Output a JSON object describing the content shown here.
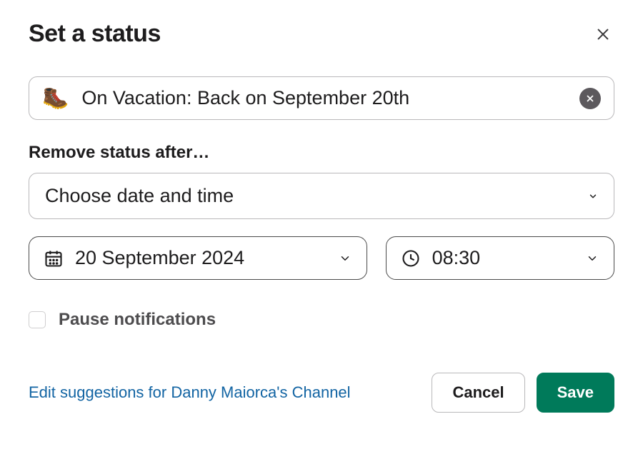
{
  "header": {
    "title": "Set a status"
  },
  "status": {
    "emoji": "🥾",
    "text": "On Vacation: Back on September 20th"
  },
  "expiry": {
    "label": "Remove status after…",
    "select_value": "Choose date and time",
    "date": "20 September 2024",
    "time": "08:30"
  },
  "pause": {
    "label": "Pause notifications",
    "checked": false
  },
  "footer": {
    "link": "Edit suggestions for Danny Maiorca's Channel",
    "cancel": "Cancel",
    "save": "Save"
  }
}
